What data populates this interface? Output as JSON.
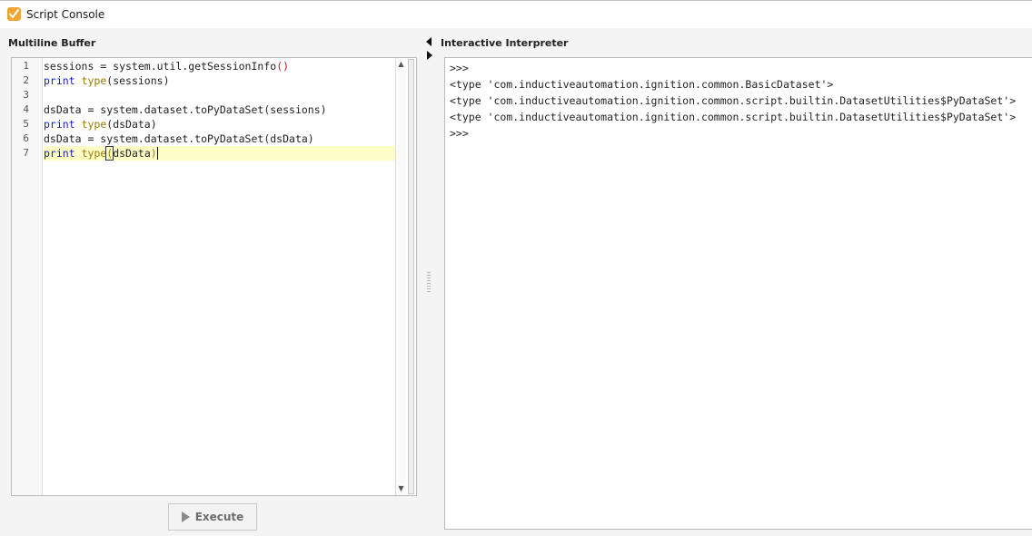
{
  "window": {
    "title": "Script Console",
    "icon": "script-console-icon",
    "accent": "#f0a431"
  },
  "left_panel": {
    "title": "Multiline Buffer",
    "line_numbers": [
      "1",
      "2",
      "3",
      "4",
      "5",
      "6",
      "7"
    ],
    "lines": [
      "sessions = system.util.getSessionInfo()",
      "print type(sessions)",
      "",
      "dsData = system.dataset.toPyDataSet(sessions)",
      "print type(dsData)",
      "dsData = system.dataset.toPyDataSet(dsData)",
      "print type(dsData)"
    ],
    "current_line": 7,
    "execute_label": "Execute"
  },
  "right_panel": {
    "title": "Interactive Interpreter",
    "output": [
      ">>>",
      "<type 'com.inductiveautomation.ignition.common.BasicDataset'>",
      "<type 'com.inductiveautomation.ignition.common.script.builtin.DatasetUtilities$PyDataSet'>",
      "<type 'com.inductiveautomation.ignition.common.script.builtin.DatasetUtilities$PyDataSet'>",
      ">>>"
    ]
  },
  "syntax_colors": {
    "keyword": "#1b1bb3",
    "builtin": "#9b7a00",
    "paren": "#c01a1a",
    "current_line_bg": "#fdfdc6"
  }
}
